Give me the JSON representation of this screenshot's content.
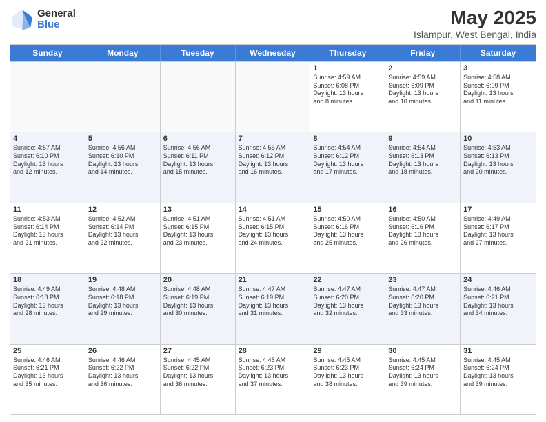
{
  "logo": {
    "general": "General",
    "blue": "Blue"
  },
  "title": "May 2025",
  "subtitle": "Islampur, West Bengal, India",
  "days_of_week": [
    "Sunday",
    "Monday",
    "Tuesday",
    "Wednesday",
    "Thursday",
    "Friday",
    "Saturday"
  ],
  "weeks": [
    [
      {
        "day": "",
        "info": ""
      },
      {
        "day": "",
        "info": ""
      },
      {
        "day": "",
        "info": ""
      },
      {
        "day": "",
        "info": ""
      },
      {
        "day": "1",
        "info": "Sunrise: 4:59 AM\nSunset: 6:08 PM\nDaylight: 13 hours\nand 8 minutes."
      },
      {
        "day": "2",
        "info": "Sunrise: 4:59 AM\nSunset: 6:09 PM\nDaylight: 13 hours\nand 10 minutes."
      },
      {
        "day": "3",
        "info": "Sunrise: 4:58 AM\nSunset: 6:09 PM\nDaylight: 13 hours\nand 11 minutes."
      }
    ],
    [
      {
        "day": "4",
        "info": "Sunrise: 4:57 AM\nSunset: 6:10 PM\nDaylight: 13 hours\nand 12 minutes."
      },
      {
        "day": "5",
        "info": "Sunrise: 4:56 AM\nSunset: 6:10 PM\nDaylight: 13 hours\nand 14 minutes."
      },
      {
        "day": "6",
        "info": "Sunrise: 4:56 AM\nSunset: 6:11 PM\nDaylight: 13 hours\nand 15 minutes."
      },
      {
        "day": "7",
        "info": "Sunrise: 4:55 AM\nSunset: 6:12 PM\nDaylight: 13 hours\nand 16 minutes."
      },
      {
        "day": "8",
        "info": "Sunrise: 4:54 AM\nSunset: 6:12 PM\nDaylight: 13 hours\nand 17 minutes."
      },
      {
        "day": "9",
        "info": "Sunrise: 4:54 AM\nSunset: 6:13 PM\nDaylight: 13 hours\nand 18 minutes."
      },
      {
        "day": "10",
        "info": "Sunrise: 4:53 AM\nSunset: 6:13 PM\nDaylight: 13 hours\nand 20 minutes."
      }
    ],
    [
      {
        "day": "11",
        "info": "Sunrise: 4:53 AM\nSunset: 6:14 PM\nDaylight: 13 hours\nand 21 minutes."
      },
      {
        "day": "12",
        "info": "Sunrise: 4:52 AM\nSunset: 6:14 PM\nDaylight: 13 hours\nand 22 minutes."
      },
      {
        "day": "13",
        "info": "Sunrise: 4:51 AM\nSunset: 6:15 PM\nDaylight: 13 hours\nand 23 minutes."
      },
      {
        "day": "14",
        "info": "Sunrise: 4:51 AM\nSunset: 6:15 PM\nDaylight: 13 hours\nand 24 minutes."
      },
      {
        "day": "15",
        "info": "Sunrise: 4:50 AM\nSunset: 6:16 PM\nDaylight: 13 hours\nand 25 minutes."
      },
      {
        "day": "16",
        "info": "Sunrise: 4:50 AM\nSunset: 6:16 PM\nDaylight: 13 hours\nand 26 minutes."
      },
      {
        "day": "17",
        "info": "Sunrise: 4:49 AM\nSunset: 6:17 PM\nDaylight: 13 hours\nand 27 minutes."
      }
    ],
    [
      {
        "day": "18",
        "info": "Sunrise: 4:49 AM\nSunset: 6:18 PM\nDaylight: 13 hours\nand 28 minutes."
      },
      {
        "day": "19",
        "info": "Sunrise: 4:48 AM\nSunset: 6:18 PM\nDaylight: 13 hours\nand 29 minutes."
      },
      {
        "day": "20",
        "info": "Sunrise: 4:48 AM\nSunset: 6:19 PM\nDaylight: 13 hours\nand 30 minutes."
      },
      {
        "day": "21",
        "info": "Sunrise: 4:47 AM\nSunset: 6:19 PM\nDaylight: 13 hours\nand 31 minutes."
      },
      {
        "day": "22",
        "info": "Sunrise: 4:47 AM\nSunset: 6:20 PM\nDaylight: 13 hours\nand 32 minutes."
      },
      {
        "day": "23",
        "info": "Sunrise: 4:47 AM\nSunset: 6:20 PM\nDaylight: 13 hours\nand 33 minutes."
      },
      {
        "day": "24",
        "info": "Sunrise: 4:46 AM\nSunset: 6:21 PM\nDaylight: 13 hours\nand 34 minutes."
      }
    ],
    [
      {
        "day": "25",
        "info": "Sunrise: 4:46 AM\nSunset: 6:21 PM\nDaylight: 13 hours\nand 35 minutes."
      },
      {
        "day": "26",
        "info": "Sunrise: 4:46 AM\nSunset: 6:22 PM\nDaylight: 13 hours\nand 36 minutes."
      },
      {
        "day": "27",
        "info": "Sunrise: 4:45 AM\nSunset: 6:22 PM\nDaylight: 13 hours\nand 36 minutes."
      },
      {
        "day": "28",
        "info": "Sunrise: 4:45 AM\nSunset: 6:23 PM\nDaylight: 13 hours\nand 37 minutes."
      },
      {
        "day": "29",
        "info": "Sunrise: 4:45 AM\nSunset: 6:23 PM\nDaylight: 13 hours\nand 38 minutes."
      },
      {
        "day": "30",
        "info": "Sunrise: 4:45 AM\nSunset: 6:24 PM\nDaylight: 13 hours\nand 39 minutes."
      },
      {
        "day": "31",
        "info": "Sunrise: 4:45 AM\nSunset: 6:24 PM\nDaylight: 13 hours\nand 39 minutes."
      }
    ]
  ]
}
